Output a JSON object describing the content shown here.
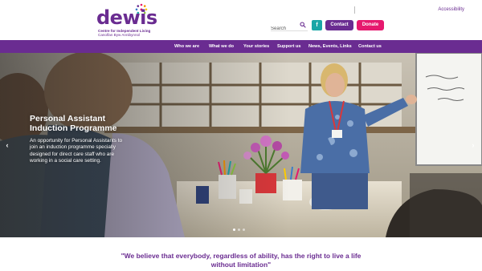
{
  "logo": {
    "word": "dewis",
    "tagline_en": "Centre for Independent Living",
    "tagline_cy": "Canolfan Byw Annibynnol"
  },
  "header": {
    "accessibility_link": "Accessibility",
    "search_placeholder": "Search",
    "facebook_label": "f",
    "contact_label": "Contact",
    "donate_label": "Donate"
  },
  "colors": {
    "brand_purple": "#6a2c91",
    "donate_pink": "#e6196e",
    "facebook_teal": "#1aa6a6"
  },
  "nav": {
    "items": [
      {
        "label": "Who we are"
      },
      {
        "label": "What we do"
      },
      {
        "label": "Your stories"
      },
      {
        "label": "Support us"
      },
      {
        "label": "News, Events, Links"
      },
      {
        "label": "Contact us"
      }
    ]
  },
  "hero": {
    "title": "Personal Assistant Induction Programme",
    "text": "An opportunity for Personal Assistants to join an induction programme specially designed for direct care staff who are working in a social care setting.",
    "prev_arrow": "‹",
    "next_arrow": "›",
    "slide_count": 3,
    "active_slide": 1
  },
  "quote": {
    "text": "\"We believe that everybody, regardless of ability, has the right to live a life without limitation\""
  }
}
